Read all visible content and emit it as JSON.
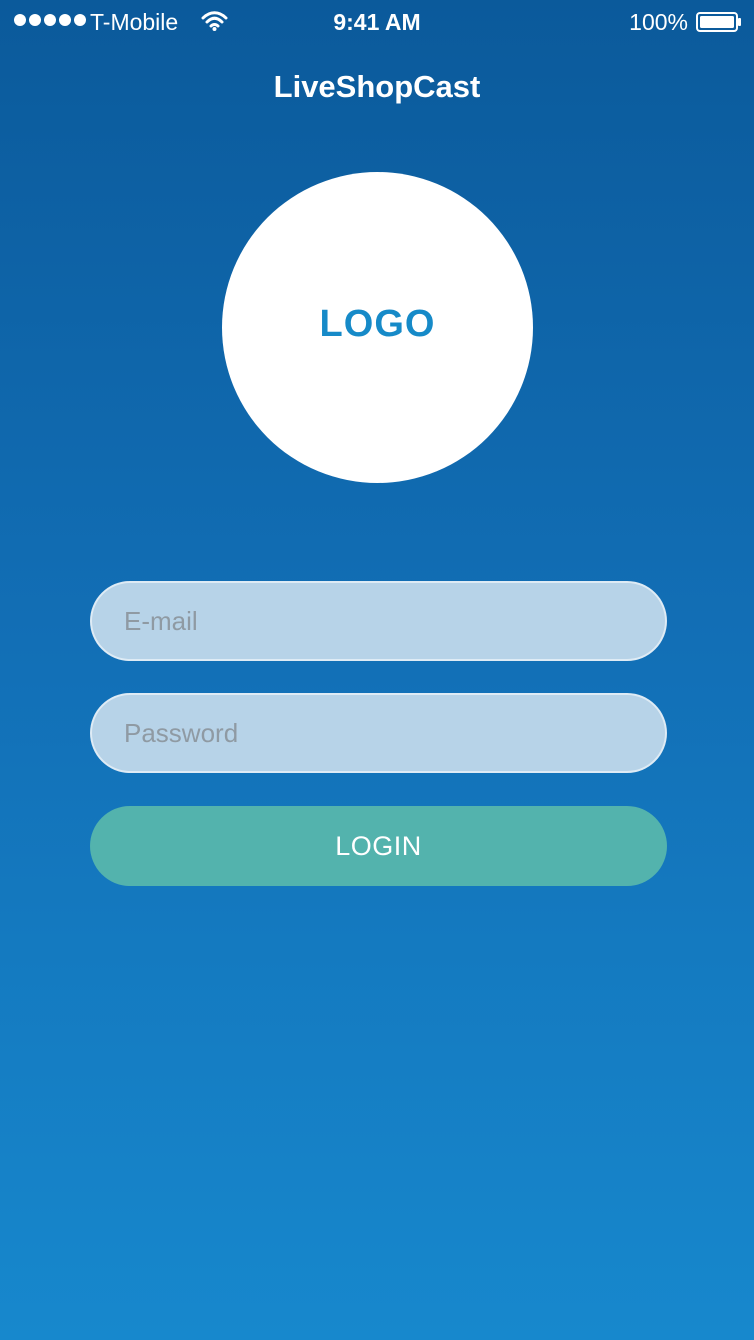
{
  "status_bar": {
    "carrier": "T-Mobile",
    "time": "9:41 AM",
    "battery": "100%",
    "icons": [
      "signal-icon",
      "wifi-icon",
      "battery-icon"
    ]
  },
  "app": {
    "title": "LiveShopCast"
  },
  "logo": {
    "text": "LOGO"
  },
  "form": {
    "email_placeholder": "E-mail",
    "password_placeholder": "Password",
    "login_label": "LOGIN"
  },
  "colors": {
    "background_top": "#0b5a9b",
    "background_bottom": "#1788cd",
    "logo_text": "#168ac8",
    "field_background": "#b7d3e8",
    "login_button": "#53b3ad"
  }
}
